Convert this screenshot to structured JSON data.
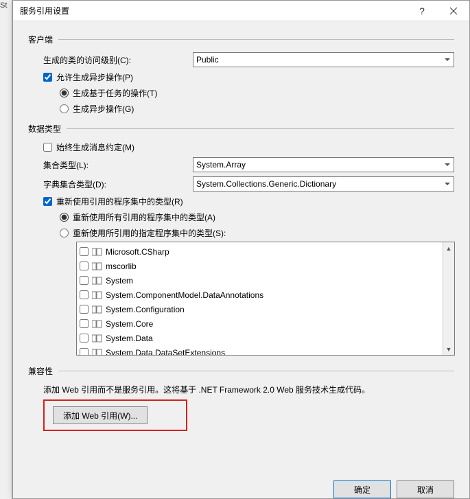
{
  "window": {
    "title": "服务引用设置",
    "help": "?",
    "close": "×"
  },
  "sections": {
    "client": "客户端",
    "dataType": "数据类型",
    "compat": "兼容性"
  },
  "client": {
    "accessLevelLabel": "生成的类的访问级别(C):",
    "accessLevelValue": "Public",
    "allowAsyncLabel": "允许生成异步操作(P)",
    "taskBasedLabel": "生成基于任务的操作(T)",
    "asyncOpLabel": "生成异步操作(G)"
  },
  "dataType": {
    "alwaysMsgContractLabel": "始终生成消息约定(M)",
    "collectionTypeLabel": "集合类型(L):",
    "collectionTypeValue": "System.Array",
    "dictTypeLabel": "字典集合类型(D):",
    "dictTypeValue": "System.Collections.Generic.Dictionary",
    "reuseTypesLabel": "重新使用引用的程序集中的类型(R)",
    "reuseAllLabel": "重新使用所有引用的程序集中的类型(A)",
    "reuseSpecifiedLabel": "重新使用所引用的指定程序集中的类型(S):"
  },
  "assemblies": [
    "Microsoft.CSharp",
    "mscorlib",
    "System",
    "System.ComponentModel.DataAnnotations",
    "System.Configuration",
    "System.Core",
    "System.Data",
    "System.Data.DataSetExtensions"
  ],
  "compat": {
    "text": "添加 Web 引用而不是服务引用。这将基于 .NET Framework 2.0 Web 服务技术生成代码。",
    "addWebRefBtn": "添加 Web 引用(W)..."
  },
  "footer": {
    "ok": "确定",
    "cancel": "取消"
  },
  "bgApp": "St"
}
